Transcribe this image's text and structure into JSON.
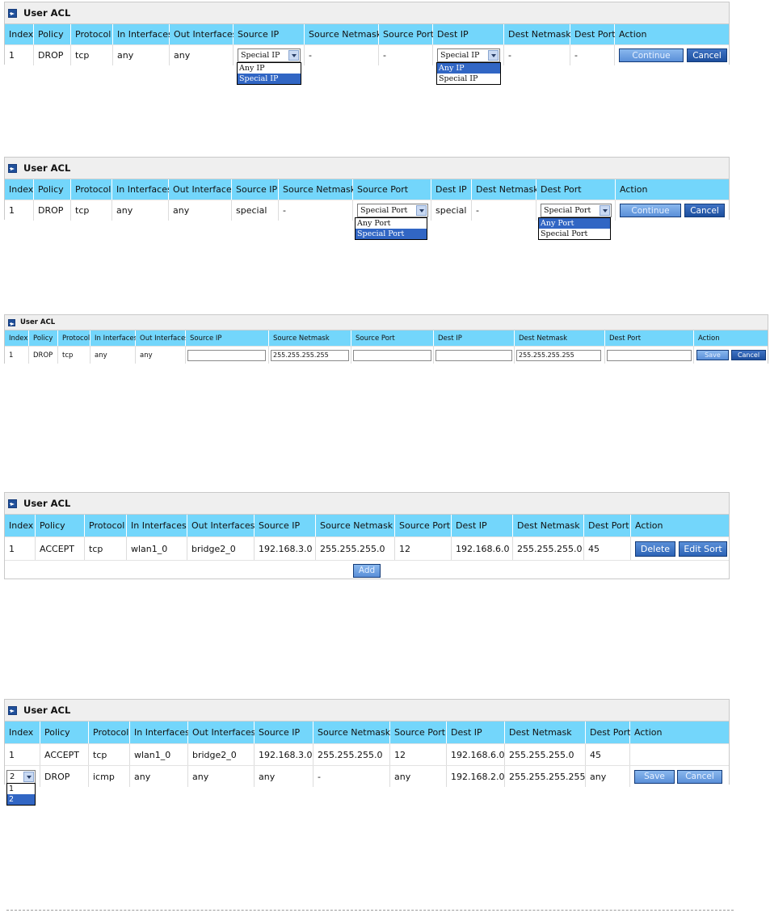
{
  "panel1": {
    "title": "User ACL",
    "headers": [
      "Index",
      "Policy",
      "Protocol",
      "In Interfaces",
      "Out Interfaces",
      "Source IP",
      "Source Netmask",
      "Source Port",
      "Dest IP",
      "Dest Netmask",
      "Dest Port",
      "Action"
    ],
    "row": {
      "index": "1",
      "policy": "DROP",
      "protocol": "tcp",
      "in": "any",
      "out": "any",
      "src_ip_select": "Special IP",
      "src_netmask": "-",
      "src_port": "-",
      "dst_ip_select": "Special IP",
      "dst_netmask": "-",
      "dst_port": "-"
    },
    "src_ip_options": [
      "Any IP",
      "Special IP"
    ],
    "dst_ip_options": [
      "Any IP",
      "Special IP"
    ],
    "continue_label": "Continue",
    "cancel_label": "Cancel"
  },
  "panel2": {
    "title": "User ACL",
    "headers": [
      "Index",
      "Policy",
      "Protocol",
      "In Interfaces",
      "Out Interfaces",
      "Source IP",
      "Source Netmask",
      "Source Port",
      "Dest IP",
      "Dest Netmask",
      "Dest Port",
      "Action"
    ],
    "row": {
      "index": "1",
      "policy": "DROP",
      "protocol": "tcp",
      "in": "any",
      "out": "any",
      "src_ip": "special",
      "src_netmask": "-",
      "src_port_select": "Special Port",
      "dst_ip": "special",
      "dst_netmask": "-",
      "dst_port_select": "Special Port"
    },
    "src_port_options": [
      "Any Port",
      "Special Port"
    ],
    "dst_port_options": [
      "Any Port",
      "Special Port"
    ],
    "continue_label": "Continue",
    "cancel_label": "Cancel"
  },
  "panel3": {
    "title": "User ACL",
    "headers": [
      "Index",
      "Policy",
      "Protocol",
      "In Interfaces",
      "Out Interfaces",
      "Source IP",
      "Source Netmask",
      "Source Port",
      "Dest IP",
      "Dest Netmask",
      "Dest Port",
      "Action"
    ],
    "row": {
      "index": "1",
      "policy": "DROP",
      "protocol": "tcp",
      "in": "any",
      "out": "any",
      "src_ip": "",
      "src_netmask": "255.255.255.255",
      "src_port": "",
      "dst_ip": "",
      "dst_netmask": "255.255.255.255",
      "dst_port": ""
    },
    "save_label": "Save",
    "cancel_label": "Cancel"
  },
  "panel4": {
    "title": "User ACL",
    "headers": [
      "Index",
      "Policy",
      "Protocol",
      "In Interfaces",
      "Out Interfaces",
      "Source IP",
      "Source Netmask",
      "Source Port",
      "Dest IP",
      "Dest Netmask",
      "Dest Port",
      "Action"
    ],
    "row": {
      "index": "1",
      "policy": "ACCEPT",
      "protocol": "tcp",
      "in": "wlan1_0",
      "out": "bridge2_0",
      "src_ip": "192.168.3.0",
      "src_netmask": "255.255.255.0",
      "src_port": "12",
      "dst_ip": "192.168.6.0",
      "dst_netmask": "255.255.255.0",
      "dst_port": "45"
    },
    "delete_label": "Delete",
    "edit_sort_label": "Edit Sort",
    "add_label": "Add"
  },
  "panel5": {
    "title": "User ACL",
    "headers": [
      "Index",
      "Policy",
      "Protocol",
      "In Interfaces",
      "Out Interfaces",
      "Source IP",
      "Source Netmask",
      "Source Port",
      "Dest IP",
      "Dest Netmask",
      "Dest Port",
      "Action"
    ],
    "rows": [
      {
        "index": "1",
        "policy": "ACCEPT",
        "protocol": "tcp",
        "in": "wlan1_0",
        "out": "bridge2_0",
        "src_ip": "192.168.3.0",
        "src_netmask": "255.255.255.0",
        "src_port": "12",
        "dst_ip": "192.168.6.0",
        "dst_netmask": "255.255.255.0",
        "dst_port": "45"
      },
      {
        "index_select": "2",
        "policy": "DROP",
        "protocol": "icmp",
        "in": "any",
        "out": "any",
        "src_ip": "any",
        "src_netmask": "-",
        "src_port": "any",
        "dst_ip": "192.168.2.0",
        "dst_netmask": "255.255.255.255",
        "dst_port": "any"
      }
    ],
    "index_options": [
      "1",
      "2"
    ],
    "save_label": "Save",
    "cancel_label": "Cancel"
  },
  "colors": {
    "header_bg": "#73d6fb",
    "title_bg": "#efefef",
    "button": "#2c63b6",
    "highlight": "#3166c4"
  }
}
